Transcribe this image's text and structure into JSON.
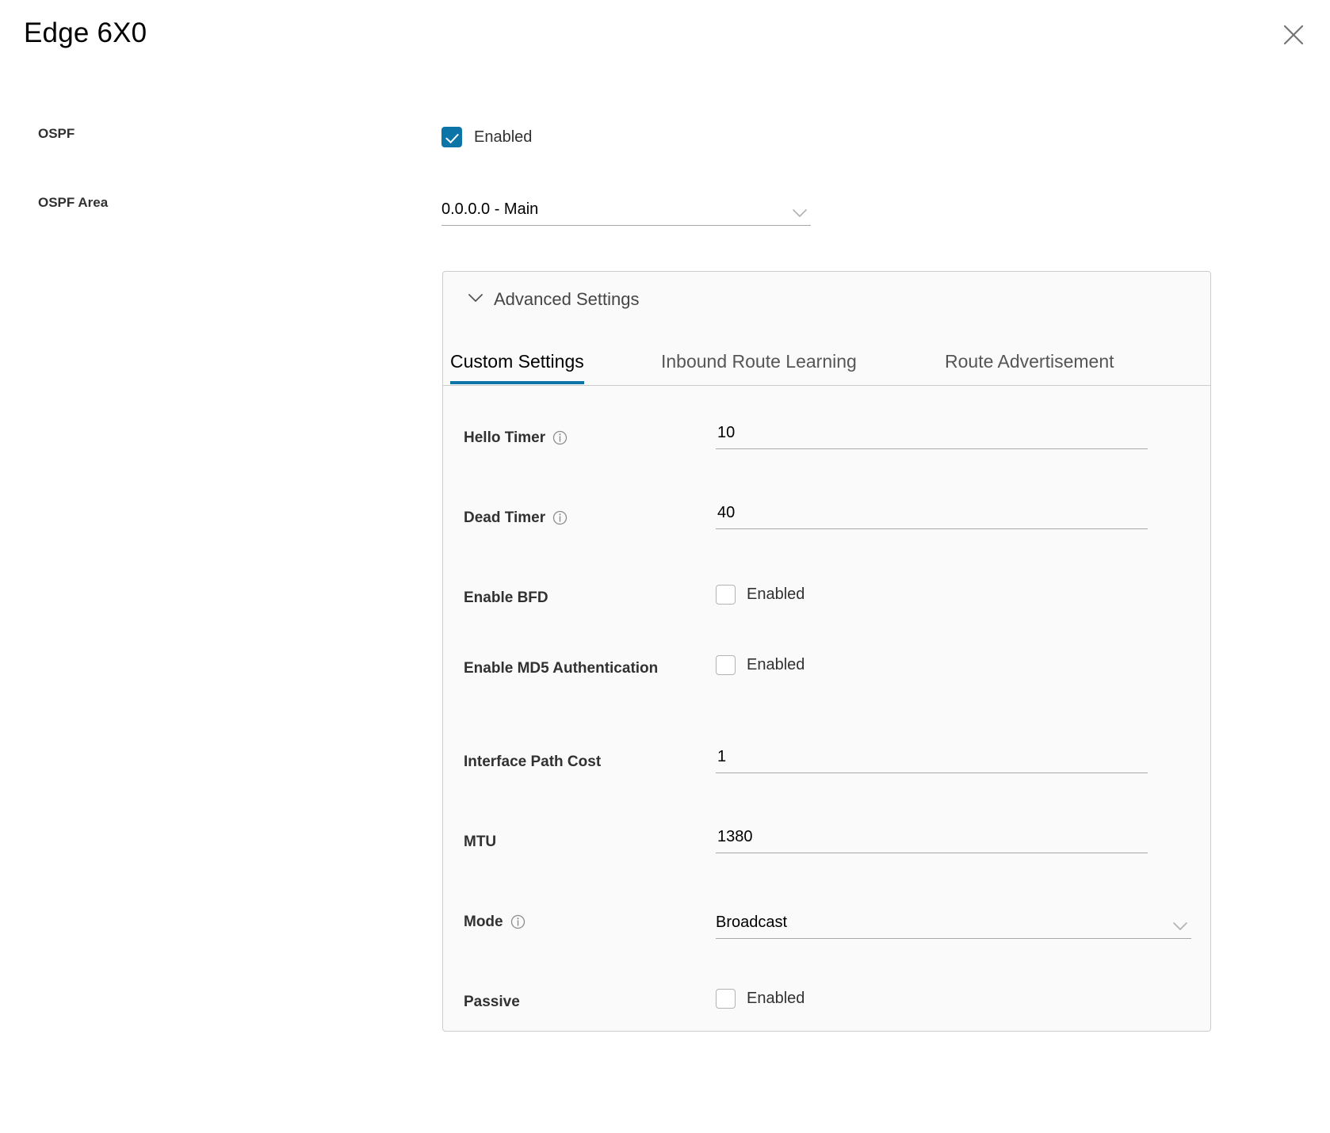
{
  "header": {
    "title": "Edge 6X0",
    "close_icon": "close-icon"
  },
  "form": {
    "ospf": {
      "label": "OSPF",
      "checkbox_label": "Enabled",
      "checked": true
    },
    "ospf_area": {
      "label": "OSPF Area",
      "value": "0.0.0.0 - Main",
      "chevron_icon": "chevron-down-icon"
    }
  },
  "advanced": {
    "title": "Advanced Settings",
    "caret_icon": "chevron-down-icon",
    "expanded": true,
    "tabs": [
      {
        "label": "Custom Settings",
        "active": true
      },
      {
        "label": "Inbound Route Learning",
        "active": false
      },
      {
        "label": "Route Advertisement",
        "active": false
      }
    ],
    "fields": {
      "hello_timer": {
        "label": "Hello Timer",
        "info_icon": "info-icon",
        "value": "10"
      },
      "dead_timer": {
        "label": "Dead Timer",
        "info_icon": "info-icon",
        "value": "40"
      },
      "enable_bfd": {
        "label": "Enable BFD",
        "checkbox_label": "Enabled",
        "checked": false
      },
      "enable_md5": {
        "label": "Enable MD5 Authentication",
        "checkbox_label": "Enabled",
        "checked": false
      },
      "interface_path_cost": {
        "label": "Interface Path Cost",
        "value": "1"
      },
      "mtu": {
        "label": "MTU",
        "value": "1380"
      },
      "mode": {
        "label": "Mode",
        "info_icon": "info-icon",
        "value": "Broadcast",
        "chevron_icon": "chevron-down-icon"
      },
      "passive": {
        "label": "Passive",
        "checkbox_label": "Enabled",
        "checked": false
      }
    }
  },
  "colors": {
    "accent": "#0d74a8",
    "panel_bg": "#fafafa",
    "panel_border": "#cccccc",
    "underline": "#a8a8a8",
    "label_text": "#313131"
  }
}
